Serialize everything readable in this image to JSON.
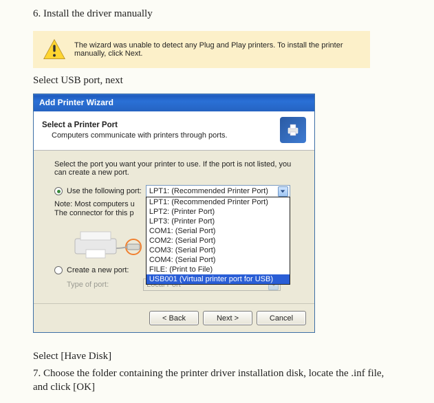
{
  "step6_title": "6. Install the driver manually",
  "warning_text": "The wizard was unable to detect any Plug and Play printers. To install the printer manually, click Next.",
  "instruction1": "Select USB port, next",
  "dialog": {
    "window_title": "Add Printer Wizard",
    "header_title": "Select a Printer Port",
    "header_sub": "Computers communicate with printers through ports.",
    "prompt": "Select the port you want your printer to use.  If the port is not listed, you can create a new port.",
    "use_port_label": "Use the following port:",
    "current_port": "LPT1: (Recommended Printer Port)",
    "port_options": [
      "LPT1: (Recommended Printer Port)",
      "LPT2: (Printer Port)",
      "LPT3: (Printer Port)",
      "COM1: (Serial Port)",
      "COM2: (Serial Port)",
      "COM3: (Serial Port)",
      "COM4: (Serial Port)",
      "FILE: (Print to File)",
      "USB001 (Virtual printer port for USB)"
    ],
    "note_line1": "Note: Most computers u",
    "note_line2": "The connector for this p",
    "create_port_label": "Create a new port:",
    "type_label": "Type of port:",
    "type_value": "Local Port",
    "back_btn": "< Back",
    "next_btn": "Next >",
    "cancel_btn": "Cancel"
  },
  "post1": "Select [Have Disk]",
  "post2": "7. Choose the folder containing the printer driver installation disk, locate the .inf file, and click [OK]"
}
